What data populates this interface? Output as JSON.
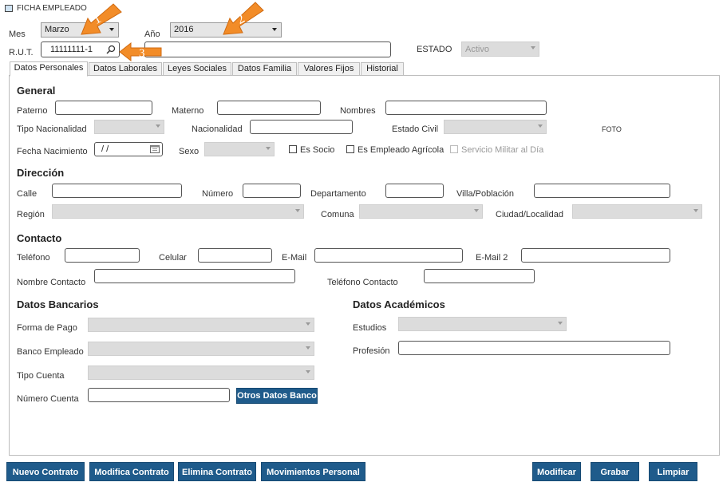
{
  "window": {
    "title": "FICHA EMPLEADO"
  },
  "header": {
    "mes_label": "Mes",
    "mes_value": "Marzo",
    "anio_label": "Año",
    "anio_value": "2016",
    "rut_label": "R.U.T.",
    "rut_value": "11111111-1",
    "estado_label": "ESTADO",
    "estado_value": "Activo"
  },
  "tabs": [
    {
      "label": "Datos Personales"
    },
    {
      "label": "Datos Laborales"
    },
    {
      "label": "Leyes Sociales"
    },
    {
      "label": "Datos Familia"
    },
    {
      "label": "Valores Fijos"
    },
    {
      "label": "Historial"
    }
  ],
  "general": {
    "title": "General",
    "paterno": "Paterno",
    "materno": "Materno",
    "nombres": "Nombres",
    "tipo_nacionalidad": "Tipo Nacionalidad",
    "nacionalidad": "Nacionalidad",
    "estado_civil": "Estado Civil",
    "foto": "FOTO",
    "fecha_nacimiento": "Fecha Nacimiento",
    "fecha_value": "/ /",
    "sexo": "Sexo",
    "es_socio": "Es Socio",
    "es_empleado_agricola": "Es Empleado Agrícola",
    "servicio_militar": "Servicio Militar al Día"
  },
  "direccion": {
    "title": "Dirección",
    "calle": "Calle",
    "numero": "Número",
    "departamento": "Departamento",
    "villa": "Villa/Población",
    "region": "Región",
    "comuna": "Comuna",
    "ciudad": "Ciudad/Localidad"
  },
  "contacto": {
    "title": "Contacto",
    "telefono": "Teléfono",
    "celular": "Celular",
    "email": "E-Mail",
    "email2": "E-Mail 2",
    "nombre_contacto": "Nombre Contacto",
    "telefono_contacto": "Teléfono Contacto"
  },
  "bancarios": {
    "title": "Datos Bancarios",
    "forma_pago": "Forma de Pago",
    "banco_empleado": "Banco Empleado",
    "tipo_cuenta": "Tipo Cuenta",
    "numero_cuenta": "Número Cuenta",
    "otros_btn": "Otros Datos Banco"
  },
  "academicos": {
    "title": "Datos Académicos",
    "estudios": "Estudios",
    "profesion": "Profesión"
  },
  "footer": {
    "nuevo": "Nuevo Contrato",
    "modifica": "Modifica Contrato",
    "elimina": "Elimina Contrato",
    "movimientos": "Movimientos Personal",
    "modificar": "Modificar",
    "grabar": "Grabar",
    "limpiar": "Limpiar"
  },
  "annotations": [
    "1",
    "2",
    "3"
  ],
  "colors": {
    "button": "#1f5b8b",
    "arrow": "#f28c28"
  }
}
